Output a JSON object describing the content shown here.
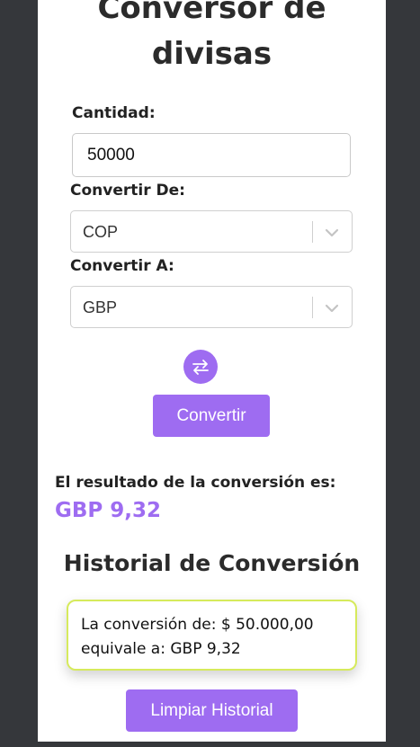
{
  "app": {
    "title": "Conversor de divisas"
  },
  "form": {
    "amount_label": "Cantidad:",
    "amount_value": "50000",
    "from_label": "Convertir De:",
    "from_value": "COP",
    "to_label": "Convertir A:",
    "to_value": "GBP",
    "swap_icon": "swap-arrows-icon",
    "convert_label": "Convertir"
  },
  "result": {
    "label": "El resultado de la conversión es:",
    "value": "GBP 9,32"
  },
  "history": {
    "title": "Historial de Conversión",
    "items": [
      {
        "line1": "La conversión de: $ 50.000,00",
        "line2": "equivale a: GBP 9,32"
      }
    ],
    "clear_label": "Limpiar Historial"
  },
  "colors": {
    "accent": "#9e6cf1",
    "history_border": "#d6ea5c",
    "page_background": "#35373b"
  }
}
